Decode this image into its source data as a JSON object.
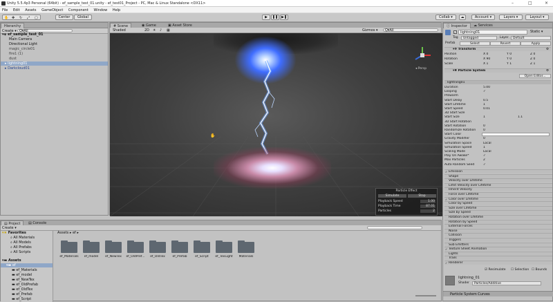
{
  "window": {
    "title": "Unity 5.5.4p3 Personal (64bit) - ef_sample_test_01.unity - ef_test01_Project - PC, Mac & Linux Standalone <DX11>",
    "minimize": "–",
    "maximize": "□",
    "close": "×"
  },
  "menu": [
    "File",
    "Edit",
    "Assets",
    "GameObject",
    "Component",
    "Window",
    "Help"
  ],
  "toolbar": {
    "center_label": "Center",
    "global_label": "Global",
    "collab_label": "Collab ▾",
    "account_label": "Account ▾",
    "layers_label": "Layers ▾",
    "layout_label": "Layout ▾"
  },
  "hierarchy": {
    "tab": "Hierarchy",
    "create": "Create ▾",
    "search": "Q▾All",
    "scene": "ef_sample_test_01",
    "items": [
      "Main Camera",
      "Directional Light",
      "magic_circle01",
      "fire1 (1)",
      "dust",
      "lightning01",
      "Darkcloud01"
    ]
  },
  "scene": {
    "tabs": [
      "Scene",
      "Game",
      "Asset Store"
    ],
    "shaded": "Shaded",
    "mode2d": "2D",
    "gizmos": "Gizmos ▾",
    "search": "Q▾All",
    "persp": "◂ Persp"
  },
  "particle_effect": {
    "title": "Particle Effect",
    "simulate": "Simulate",
    "stop": "Stop",
    "rows": [
      {
        "label": "Playback Speed",
        "value": "1.00"
      },
      {
        "label": "Playback Time",
        "value": "87.01"
      },
      {
        "label": "Particles",
        "value": "2"
      }
    ]
  },
  "project": {
    "tabs": [
      "Project",
      "Console"
    ],
    "create": "Create ▾",
    "breadcrumb": "Assets ▸ ef ▸",
    "favorites_label": "Favorites",
    "favorites": [
      "All Materials",
      "All Models",
      "All Prefabs",
      "All Scripts"
    ],
    "assets_label": "Assets",
    "tree": [
      "ef",
      "ef_Materials",
      "ef_model",
      "ef_NewTex",
      "ef_OldPrefab",
      "ef_OldTex",
      "ef_Prefab",
      "ef_Script"
    ],
    "folders": [
      "ef_Materials",
      "ef_model",
      "ef_NewTex",
      "ef_OldPref...",
      "ef_OldTex",
      "ef_Prefab",
      "ef_Script",
      "ef_TexLight",
      "Materials"
    ]
  },
  "inspector": {
    "tabs": [
      "Inspector",
      "Services"
    ],
    "object_name": "lightning01",
    "static": "Static ▾",
    "tag_label": "Tag",
    "tag": "Untagged",
    "layer_label": "Layer",
    "layer": "Default",
    "prefab_label": "Prefab",
    "select": "Select",
    "revert": "Revert",
    "apply": "Apply",
    "transform": {
      "title": "Transform",
      "rows": [
        {
          "label": "Position",
          "x": "0",
          "y": "0",
          "z": "0"
        },
        {
          "label": "Rotation",
          "x": "90",
          "y": "0",
          "z": "0"
        },
        {
          "label": "Scale",
          "x": "1",
          "y": "1",
          "z": "1"
        }
      ]
    },
    "particle_system": {
      "title": "Particle System",
      "open_editor": "Open Editor...",
      "name": "lightning01",
      "params": [
        {
          "label": "Duration",
          "value": "5.00"
        },
        {
          "label": "Looping",
          "value": "✓"
        },
        {
          "label": "Prewarm",
          "value": ""
        },
        {
          "label": "Start Delay",
          "value": "0.5"
        },
        {
          "label": "Start Lifetime",
          "value": "1"
        },
        {
          "label": "Start Speed",
          "value": "0.01"
        },
        {
          "label": "3D Start Size",
          "value": ""
        },
        {
          "label": "Start Size",
          "value": "1",
          "value2": "1.1"
        },
        {
          "label": "3D Start Rotation",
          "value": ""
        },
        {
          "label": "Start Rotation",
          "value": "0"
        },
        {
          "label": "Randomize Rotation",
          "value": "0"
        },
        {
          "label": "Start Color",
          "value": ""
        },
        {
          "label": "Gravity Modifier",
          "value": "0"
        },
        {
          "label": "Simulation Space",
          "value": "Local"
        },
        {
          "label": "Simulation Speed",
          "value": "1"
        },
        {
          "label": "Scaling Mode",
          "value": "Local"
        },
        {
          "label": "Play On Awake*",
          "value": "✓"
        },
        {
          "label": "Max Particles",
          "value": "2"
        },
        {
          "label": "Auto Random Seed",
          "value": "✓"
        }
      ],
      "modules": [
        "Emission",
        "Shape",
        "Velocity over Lifetime",
        "Limit Velocity over Lifetime",
        "Inherit Velocity",
        "Force over Lifetime",
        "Color over Lifetime",
        "Color by Speed",
        "Size over Lifetime",
        "Size by Speed",
        "Rotation over Lifetime",
        "Rotation by Speed",
        "External Forces",
        "Noise",
        "Collision",
        "Triggers",
        "Sub Emitters",
        "Texture Sheet Animation",
        "Lights",
        "Trails",
        "Renderer"
      ],
      "modules_checked": [
        true,
        false,
        false,
        false,
        false,
        false,
        true,
        false,
        false,
        false,
        false,
        false,
        false,
        false,
        false,
        false,
        false,
        true,
        false,
        false,
        true
      ]
    },
    "footer": {
      "resimulate": "Resimulate",
      "selection": "Selection",
      "bounds": "Bounds",
      "material_name": "lightning_01",
      "shader_label": "Shader",
      "shader": "Particles/Additive",
      "curves": "Particle System Curves"
    }
  }
}
